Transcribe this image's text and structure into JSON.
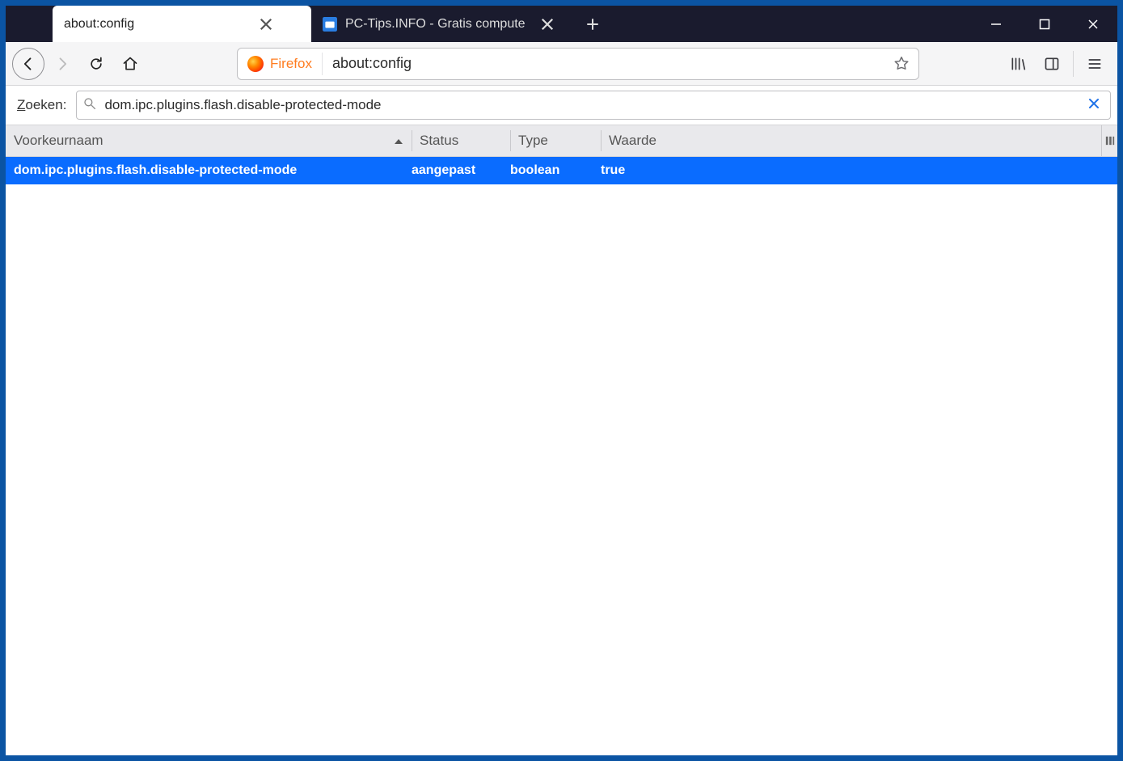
{
  "tabs": {
    "items": [
      {
        "label": "about:config",
        "active": true
      },
      {
        "label": "PC-Tips.INFO - Gratis compute",
        "active": false
      }
    ]
  },
  "url": {
    "identity_label": "Firefox",
    "value": "about:config"
  },
  "search": {
    "label_prefix": "Z",
    "label_rest": "oeken:",
    "value": "dom.ipc.plugins.flash.disable-protected-mode"
  },
  "columns": {
    "name": "Voorkeurnaam",
    "status": "Status",
    "type": "Type",
    "value": "Waarde"
  },
  "rows": [
    {
      "name": "dom.ipc.plugins.flash.disable-protected-mode",
      "status": "aangepast",
      "type": "boolean",
      "value": "true"
    }
  ]
}
